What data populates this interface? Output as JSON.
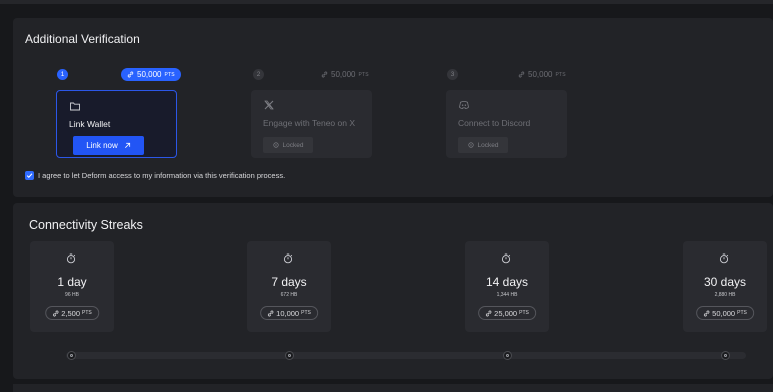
{
  "verification": {
    "title": "Additional Verification",
    "steps": [
      {
        "number": "1",
        "points": "50,000",
        "unit": "PTS",
        "label": "Link Wallet",
        "button": "Link now",
        "icon": "folder-icon"
      },
      {
        "number": "2",
        "points": "50,000",
        "unit": "PTS",
        "label": "Engage with Teneo on X",
        "status": "Locked",
        "icon": "x-logo-icon"
      },
      {
        "number": "3",
        "points": "50,000",
        "unit": "PTS",
        "label": "Connect to Discord",
        "status": "Locked",
        "icon": "discord-icon"
      }
    ],
    "consent": {
      "checked": true,
      "text": "I agree to let Deform access to my information via this verification process."
    }
  },
  "streaks": {
    "title": "Connectivity Streaks",
    "items": [
      {
        "days": "1 day",
        "hb": "96 HB",
        "points": "2,500",
        "unit": "PTS"
      },
      {
        "days": "7 days",
        "hb": "672 HB",
        "points": "10,000",
        "unit": "PTS"
      },
      {
        "days": "14 days",
        "hb": "1,344 HB",
        "points": "25,000",
        "unit": "PTS"
      },
      {
        "days": "30 days",
        "hb": "2,880 HB",
        "points": "50,000",
        "unit": "PTS"
      }
    ]
  },
  "colors": {
    "accent": "#2962ff",
    "background": "#17181b",
    "panel": "#222327",
    "card": "#2a2b30"
  }
}
